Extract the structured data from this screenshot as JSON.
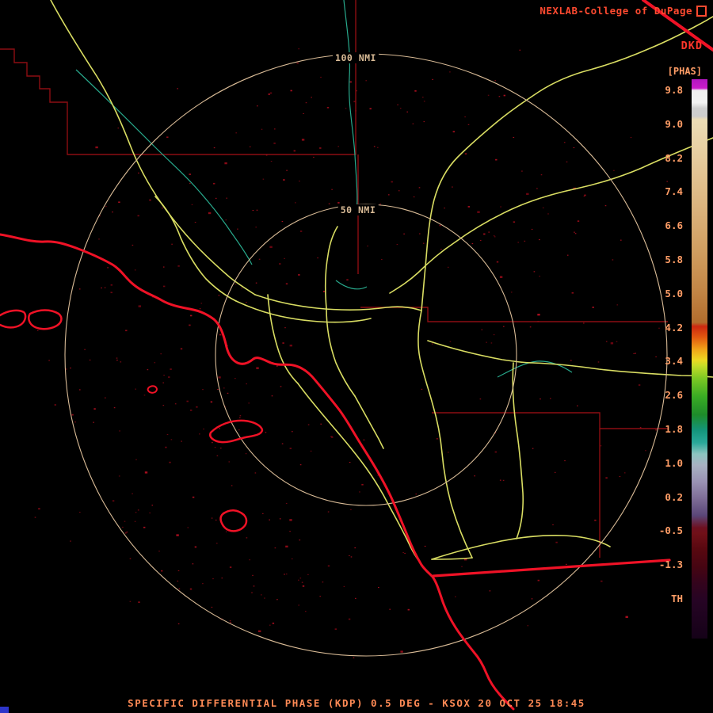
{
  "header": {
    "brand": "NEXLAB-College of DuPage",
    "product_code": "DKD",
    "product_tag": "[PHAS]"
  },
  "colorbar": {
    "labels": [
      "9.8",
      "9.0",
      "8.2",
      "7.4",
      "6.6",
      "5.8",
      "5.0",
      "4.2",
      "3.4",
      "2.6",
      "1.8",
      "1.0",
      "0.2",
      "-0.5",
      "-1.3",
      "TH"
    ],
    "palette": [
      {
        "pos": 0,
        "color": "#b216bf"
      },
      {
        "pos": 1.6,
        "color": "#c91cc9"
      },
      {
        "pos": 2.0,
        "color": "#efefef"
      },
      {
        "pos": 4.2,
        "color": "#f2f2f2"
      },
      {
        "pos": 5.2,
        "color": "#cfcfcf"
      },
      {
        "pos": 6.6,
        "color": "#cdcdcd"
      },
      {
        "pos": 7.2,
        "color": "#ecddb6"
      },
      {
        "pos": 15,
        "color": "#e5c99a"
      },
      {
        "pos": 23,
        "color": "#dbb37d"
      },
      {
        "pos": 31,
        "color": "#cf9d5f"
      },
      {
        "pos": 38,
        "color": "#c28545"
      },
      {
        "pos": 43.5,
        "color": "#b26d2d"
      },
      {
        "pos": 44.2,
        "color": "#cc2810"
      },
      {
        "pos": 46.2,
        "color": "#e25a10"
      },
      {
        "pos": 48.2,
        "color": "#f0a018"
      },
      {
        "pos": 50.2,
        "color": "#ecd822"
      },
      {
        "pos": 51.2,
        "color": "#c6dc28"
      },
      {
        "pos": 53.5,
        "color": "#7cc824"
      },
      {
        "pos": 56.7,
        "color": "#3aac24"
      },
      {
        "pos": 60,
        "color": "#1e8c2a"
      },
      {
        "pos": 62.8,
        "color": "#14947c"
      },
      {
        "pos": 65,
        "color": "#2aa89a"
      },
      {
        "pos": 67,
        "color": "#8cc4c0"
      },
      {
        "pos": 69,
        "color": "#a8b2c2"
      },
      {
        "pos": 72,
        "color": "#9a92b4"
      },
      {
        "pos": 75,
        "color": "#7e6c96"
      },
      {
        "pos": 78,
        "color": "#5a4678"
      },
      {
        "pos": 80.2,
        "color": "#6e1020"
      },
      {
        "pos": 81.2,
        "color": "#701018"
      },
      {
        "pos": 84,
        "color": "#580810"
      },
      {
        "pos": 87.2,
        "color": "#460512"
      },
      {
        "pos": 90,
        "color": "#34041c"
      },
      {
        "pos": 93.2,
        "color": "#260424"
      },
      {
        "pos": 100,
        "color": "#150218"
      }
    ]
  },
  "range_rings": {
    "labels": [
      "100 NMI",
      "50 NMI"
    ]
  },
  "caption": {
    "text": "SPECIFIC DIFFERENTIAL PHASE (KDP) 0.5 DEG - KSOX 20 OCT 25 18:45"
  },
  "colors": {
    "brand_text": "#ff4a30",
    "code_text": "#ff362a",
    "tag_text": "#ff9d66",
    "scale_text": "#ff9d66",
    "caption_text": "#ff8a55",
    "ring": "#d9bb96",
    "coast": "#ef1226",
    "road": "#d9dd62",
    "river": "#28a98c",
    "county": "#8c0d12",
    "chip": "#2d35c9",
    "speckle_dark": "#6a0510",
    "speckle_mid": "#8a0a16",
    "speckle_bright": "#a60e1e"
  }
}
